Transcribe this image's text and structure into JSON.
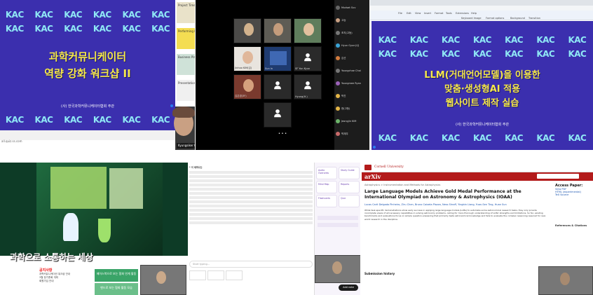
{
  "panel1": {
    "logo": "KAC",
    "title_line1": "과학커뮤니케이터",
    "title_line2": "역량 강화 워크샵 II",
    "footer": "(사) 한국과학커뮤니케이터협회 주관",
    "url_hint": "all.quiz.ss.com",
    "thumbnails": [
      "Project Timeline Presentation",
      "Performing Proposal Presentation",
      "Business Plan Presentation",
      "Presentation"
    ],
    "speaker_name": "Kyungsiker Choi (조경식)"
  },
  "panel2": {
    "tiles": [
      "",
      "",
      "",
      "",
      "",
      "",
      "Jinhoo KIM(김)",
      "Sun In",
      "SF Yun Kyun",
      "김은경(3F)",
      "Hyung(H.)",
      ""
    ],
    "participants": [
      "Mudsat Suv",
      "고승",
      "조지(고등)",
      "Hyun Gyun(나)",
      "김선",
      "Youngchae Choi",
      "Youngmee Ryan",
      "박진",
      "현(고등)",
      "Jeongjin KIM",
      "박재우"
    ]
  },
  "panel3": {
    "logo": "KAC",
    "title_line1": "LLM(거대언어모델)을 이용한",
    "title_line2": "맞춤·생성형AI 적용",
    "title_line3": "웹사이트 제작 실습",
    "footer": "(사) 한국과학커뮤니케이터협회 주관",
    "toolbar": [
      "File",
      "Edit",
      "View",
      "Insert",
      "Format",
      "Tools",
      "Extensions",
      "Help"
    ],
    "slide_tools": [
      "Keyboard Image",
      "Format options",
      "Background",
      "Transition"
    ]
  },
  "panel4": {
    "hero_title": "과학으로 소통하는 세상",
    "notice_title": "공지사항",
    "notice_items": [
      "과학커뮤니케이션 워크샵 안내",
      "3월 정기총회 개최",
      "회원가입 안내"
    ],
    "button1": "페이스북으로 보는 협회 연계 활동",
    "button2": "밴드로 보는 협회 활동 모습"
  },
  "panel5": {
    "assistant_items": [
      "Audio Overview",
      "Study Guide",
      "Mind Map",
      "Reports",
      "Flashcards",
      "Quiz"
    ],
    "input_placeholder": "Start typing...",
    "add_note": "Add note",
    "doc_heading": "* 이 세미나는"
  },
  "panel6": {
    "university": "Cornell University",
    "arxiv_logo": "arXiv",
    "category": "Astrophysics > Instrumentation and Methods for Astrophysics",
    "title": "Large Language Models Achieve Gold Medal Performance at the International Olympiad on Astronomy & Astrophysics (IOAA)",
    "authors": "Lucas Carit Delgado Pinheiro, Ziru Chen, Bruno Caixeta Piazza, Ness Shroff, Yingbin Liang, Yuan-Sen Ting, Huan Sun",
    "abstract": "While task-specific demonstrations show early success in applying large language models (LLMs) to automate some astronomical research tasks, they only provide incomplete views of all necessary capabilities in solving astronomy problems, calling for more thorough understanding of LLMs' strengths and limitations. So far, existing benchmarks and evaluations focus on simple question-answering that primarily tests astronomical knowledge and fails to evaluate the complex reasoning required for real-world research in the discipline.",
    "sidebar_title": "Access Paper:",
    "sidebar_links": [
      "View PDF",
      "HTML (experimental)",
      "TeX Source"
    ],
    "sidebar_refs": "References & Citations",
    "submission": "Submission history"
  }
}
